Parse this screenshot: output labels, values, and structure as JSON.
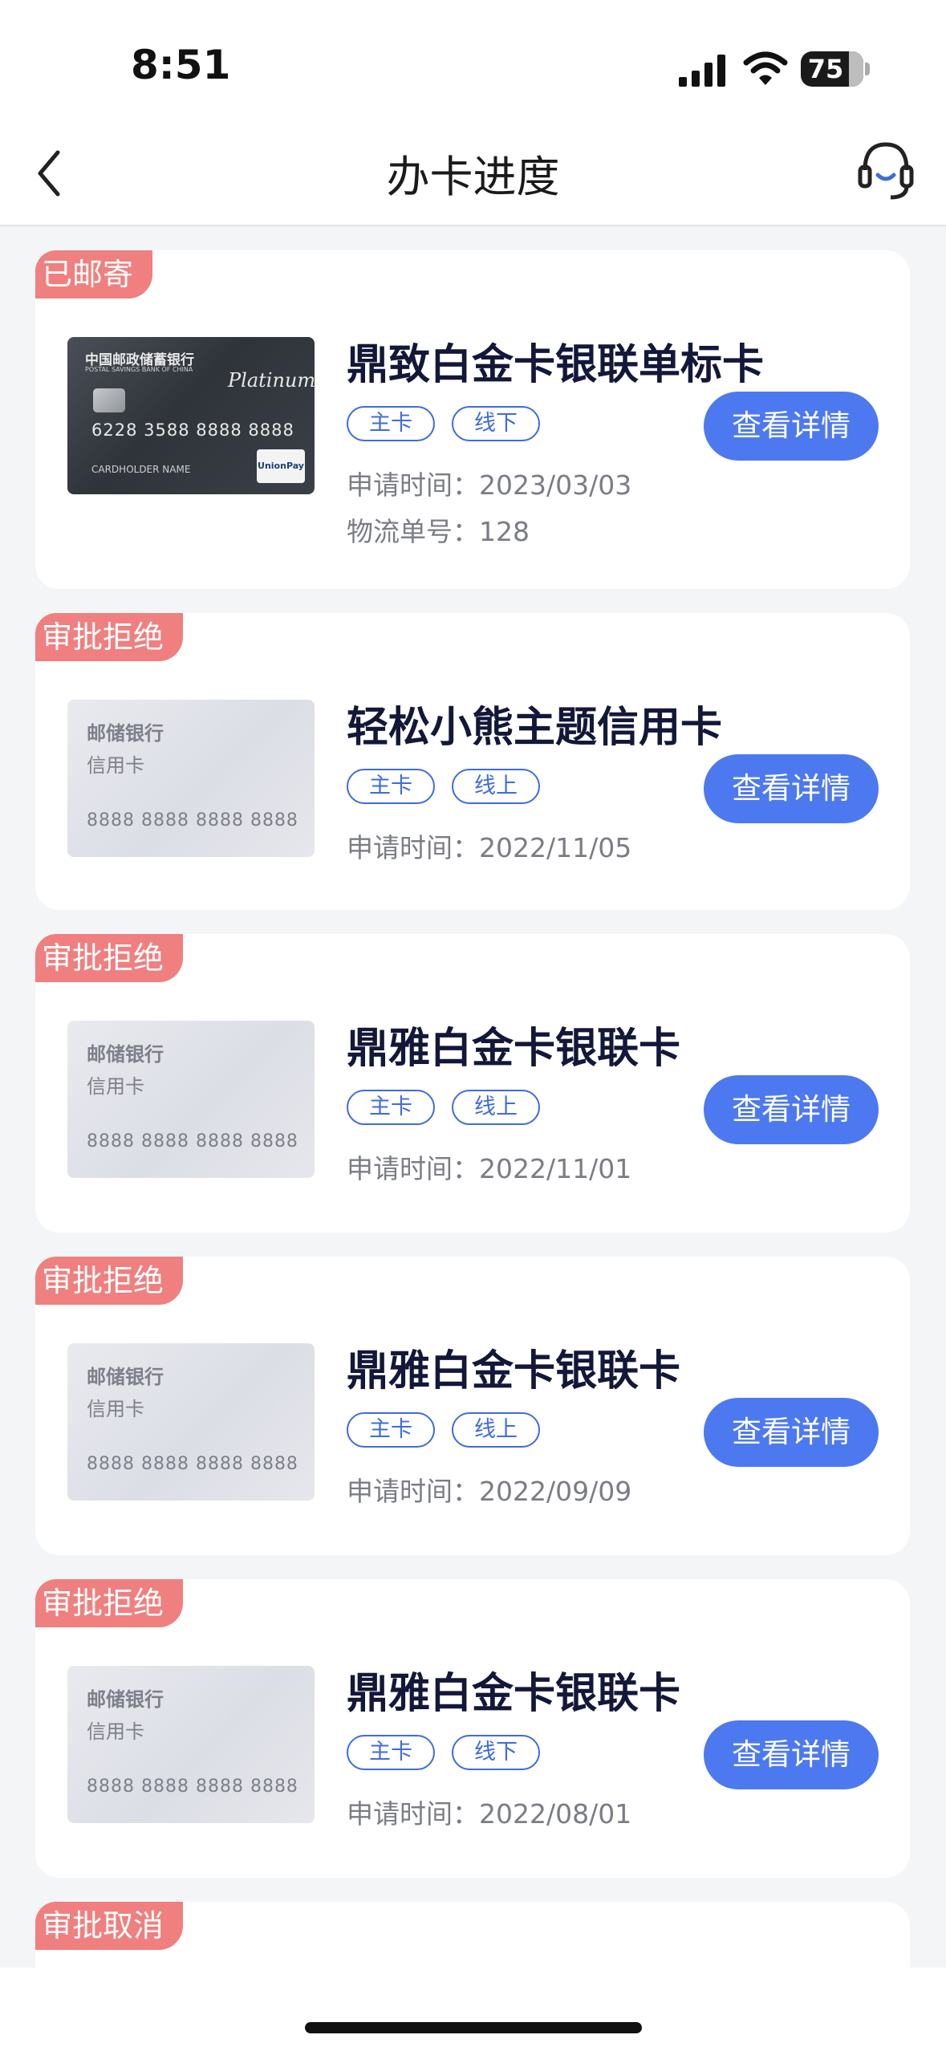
{
  "status_bar": {
    "time": "8:51",
    "battery": "75"
  },
  "nav": {
    "title": "办卡进度"
  },
  "labels": {
    "apply_time": "申请时间：",
    "tracking": "物流单号："
  },
  "cards": [
    {
      "status": "已邮寄",
      "name": "鼎致白金卡银联单标卡",
      "tags": [
        "主卡",
        "线下"
      ],
      "apply_time": "2023/03/03",
      "tracking_no": "128",
      "button": "查看详情",
      "image": {
        "style": "platinum",
        "bank": "中国邮政储蓄银行",
        "bank_en": "POSTAL SAVINGS BANK OF CHINA",
        "script": "Platinum",
        "number": "6228 3588 8888 8888",
        "holder": "CARDHOLDER NAME",
        "network": "UnionPay 银联"
      }
    },
    {
      "status": "审批拒绝",
      "name": "轻松小熊主题信用卡",
      "tags": [
        "主卡",
        "线上"
      ],
      "apply_time": "2022/11/05",
      "button": "查看详情",
      "image": {
        "style": "generic",
        "bank": "邮储银行",
        "type": "信用卡",
        "number": "8888 8888 8888 8888"
      }
    },
    {
      "status": "审批拒绝",
      "name": "鼎雅白金卡银联卡",
      "tags": [
        "主卡",
        "线上"
      ],
      "apply_time": "2022/11/01",
      "button": "查看详情",
      "image": {
        "style": "generic",
        "bank": "邮储银行",
        "type": "信用卡",
        "number": "8888 8888 8888 8888"
      }
    },
    {
      "status": "审批拒绝",
      "name": "鼎雅白金卡银联卡",
      "tags": [
        "主卡",
        "线上"
      ],
      "apply_time": "2022/09/09",
      "button": "查看详情",
      "image": {
        "style": "generic",
        "bank": "邮储银行",
        "type": "信用卡",
        "number": "8888 8888 8888 8888"
      }
    },
    {
      "status": "审批拒绝",
      "name": "鼎雅白金卡银联卡",
      "tags": [
        "主卡",
        "线下"
      ],
      "apply_time": "2022/08/01",
      "button": "查看详情",
      "image": {
        "style": "generic",
        "bank": "邮储银行",
        "type": "信用卡",
        "number": "8888 8888 8888 8888"
      }
    },
    {
      "status": "审批取消"
    }
  ],
  "colors": {
    "accent": "#4d79f0",
    "status_tag": "#f07f7f",
    "title": "#13183a"
  }
}
